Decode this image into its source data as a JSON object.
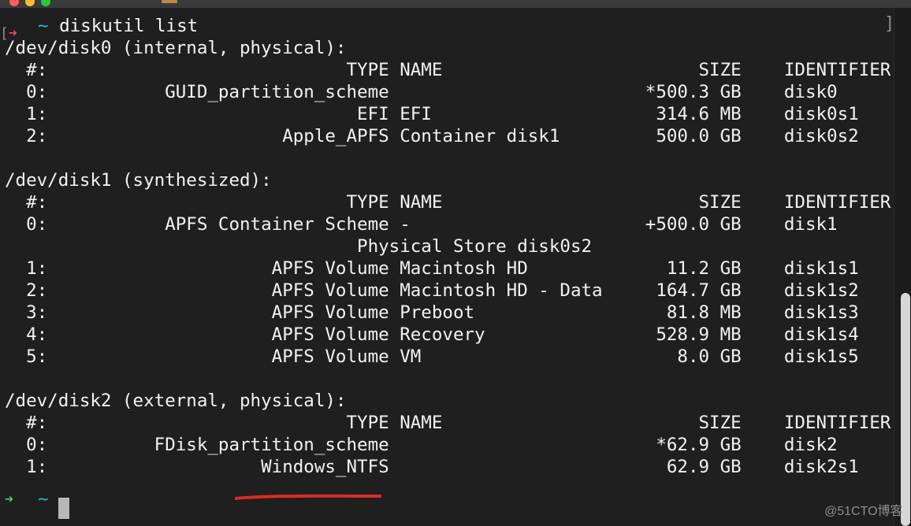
{
  "app": {
    "name": "Terminal"
  },
  "colors": {
    "background": "#1f1f1f",
    "text": "#f2f2f2",
    "prompt_red": "#e24c44",
    "prompt_cyan": "#28b8d4",
    "prompt_green": "#49d05a",
    "annotation": "#d92c24",
    "scroll_thumb": "#d7d7d7"
  },
  "terminal": {
    "prompt_arrow": "➜",
    "prompt_tilde": "~",
    "command": "diskutil list",
    "disks": [
      {
        "header": "/dev/disk0 (internal, physical):",
        "columns": {
          "number": "#:",
          "type": "TYPE",
          "name": "NAME",
          "size": "SIZE",
          "identifier": "IDENTIFIER"
        },
        "rows": [
          {
            "number": "0:",
            "type": "GUID_partition_scheme",
            "name": "",
            "size": "*500.3 GB",
            "identifier": "disk0"
          },
          {
            "number": "1:",
            "type": "EFI",
            "name": "EFI",
            "size": "314.6 MB",
            "identifier": "disk0s1"
          },
          {
            "number": "2:",
            "type": "Apple_APFS",
            "name": "Container disk1",
            "size": "500.0 GB",
            "identifier": "disk0s2"
          }
        ]
      },
      {
        "header": "/dev/disk1 (synthesized):",
        "columns": {
          "number": "#:",
          "type": "TYPE",
          "name": "NAME",
          "size": "SIZE",
          "identifier": "IDENTIFIER"
        },
        "rows": [
          {
            "number": "0:",
            "type": "APFS Container Scheme",
            "name": "-",
            "size": "+500.0 GB",
            "identifier": "disk1"
          },
          {
            "number": "",
            "type": "",
            "name": "Physical Store disk0s2",
            "size": "",
            "identifier": ""
          },
          {
            "number": "1:",
            "type": "APFS Volume",
            "name": "Macintosh HD",
            "size": "11.2 GB",
            "identifier": "disk1s1"
          },
          {
            "number": "2:",
            "type": "APFS Volume",
            "name": "Macintosh HD - Data",
            "size": "164.7 GB",
            "identifier": "disk1s2"
          },
          {
            "number": "3:",
            "type": "APFS Volume",
            "name": "Preboot",
            "size": "81.8 MB",
            "identifier": "disk1s3"
          },
          {
            "number": "4:",
            "type": "APFS Volume",
            "name": "Recovery",
            "size": "528.9 MB",
            "identifier": "disk1s4"
          },
          {
            "number": "5:",
            "type": "APFS Volume",
            "name": "VM",
            "size": "8.0 GB",
            "identifier": "disk1s5"
          }
        ]
      },
      {
        "header": "/dev/disk2 (external, physical):",
        "columns": {
          "number": "#:",
          "type": "TYPE",
          "name": "NAME",
          "size": "SIZE",
          "identifier": "IDENTIFIER"
        },
        "rows": [
          {
            "number": "0:",
            "type": "FDisk_partition_scheme",
            "name": "",
            "size": "*62.9 GB",
            "identifier": "disk2"
          },
          {
            "number": "1:",
            "type": "Windows_NTFS",
            "name": "",
            "size": "62.9 GB",
            "identifier": "disk2s1"
          }
        ]
      }
    ]
  },
  "watermark": "@51CTO博客",
  "icons": {
    "traffic_lights": [
      "close-window-icon",
      "minimize-window-icon",
      "zoom-window-icon"
    ],
    "title": "terminal-title-icon",
    "cursor": "terminal-cursor"
  }
}
